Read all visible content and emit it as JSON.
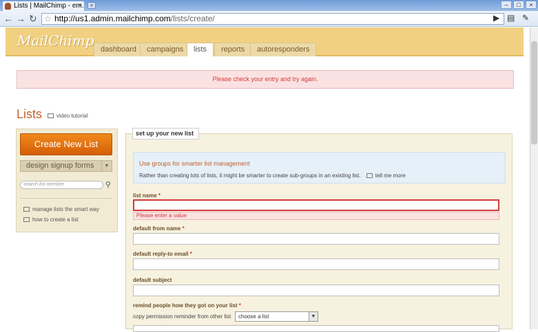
{
  "browser": {
    "tab_title": "Lists | MailChimp - em...",
    "new_tab": "+",
    "url_host": "http://us1.admin.mailchimp.com",
    "url_path": "/lists/create/"
  },
  "header": {
    "logo": "MailChimp",
    "tabs": [
      {
        "label": "dashboard"
      },
      {
        "label": "campaigns"
      },
      {
        "label": "lists"
      },
      {
        "label": "reports"
      },
      {
        "label": "autoresponders"
      }
    ],
    "active_tab": "lists"
  },
  "alert": {
    "message": "Please check your entry and try again."
  },
  "page": {
    "title": "Lists",
    "video_tutorial": "video tutorial"
  },
  "sidebar": {
    "create_button": "Create New List",
    "design_button": "design signup forms",
    "search_placeholder": "search list member",
    "links": [
      {
        "label": "manage lists the smart way"
      },
      {
        "label": "how to create a list"
      }
    ]
  },
  "form": {
    "legend": "set up your new list",
    "info_title": "Use groups for smarter list management",
    "info_text": "Rather than creating lots of lists, it might be smarter to create sub-groups in an existing list.",
    "tell_me_more": "tell me more",
    "list_name_label": "list name",
    "list_name_value": "",
    "error_message": "Please enter a value",
    "from_name_label": "default from name",
    "reply_to_label": "default reply-to email",
    "subject_label": "default subject",
    "remind_label": "remind people how they got on your list",
    "required_marker": "*",
    "copy_label": "copy permission reminder from other list",
    "copy_select_value": "choose a list"
  },
  "colors": {
    "header_bg": "#f1d082",
    "accent_orange": "#d45e08",
    "error_red": "#d23b3b",
    "title_orange": "#c2602b"
  }
}
